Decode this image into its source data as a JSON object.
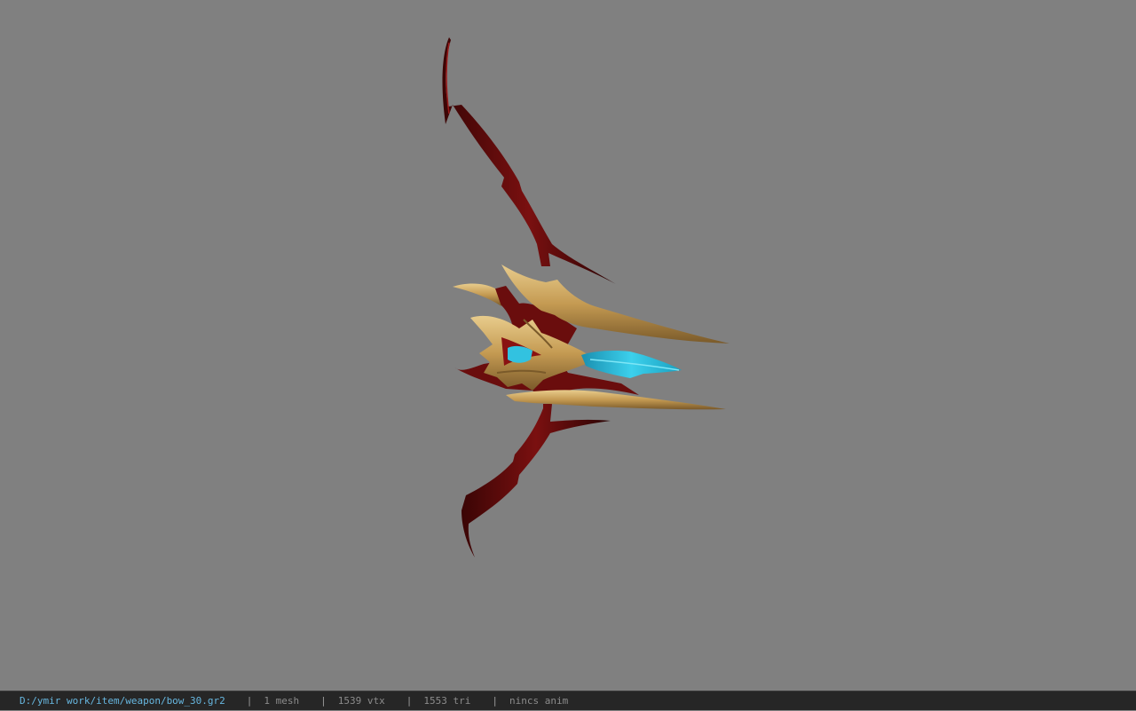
{
  "viewer": {
    "background_color": "#808080",
    "model": {
      "icon": "bow-model",
      "colors": {
        "limb": "#5c0a0a",
        "limb_highlight": "#8a1414",
        "gold": "#c9a35c",
        "gold_highlight": "#e6c987",
        "gem": "#28b4d2"
      }
    }
  },
  "status_bar": {
    "file_path": "D:/ymir work/item/weapon/bow_30.gr2",
    "separator": "|",
    "mesh_count": "1 mesh",
    "vertex_count": "1539 vtx",
    "triangle_count": "1553 tri",
    "anim_info": "nincs anim"
  }
}
